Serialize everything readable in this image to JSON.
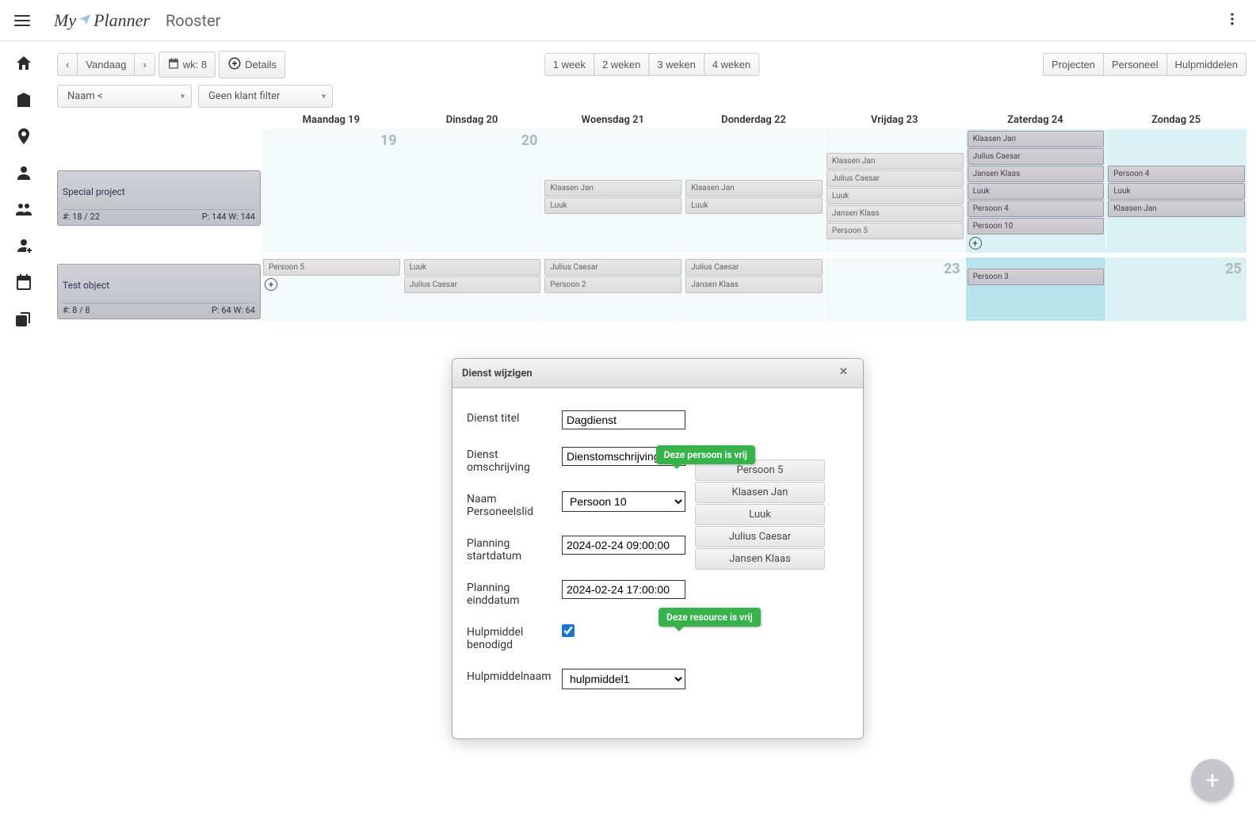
{
  "app": {
    "logo_left": "My",
    "logo_right": "Planner",
    "page_title": "Rooster"
  },
  "toolbar": {
    "prev": "‹",
    "today": "Vandaag",
    "next": "›",
    "week_label": "wk: 8",
    "details": "Details",
    "ranges": [
      "1 week",
      "2 weken",
      "3 weken",
      "4 weken"
    ],
    "right_tabs": [
      "Projecten",
      "Personeel",
      "Hulpmiddelen"
    ]
  },
  "filters": {
    "sort": "Naam <",
    "client": "Geen klant filter"
  },
  "days": [
    "Maandag 19",
    "Dinsdag 20",
    "Woensdag 21",
    "Donderdag 22",
    "Vrijdag 23",
    "Zaterdag 24",
    "Zondag 25"
  ],
  "daynums": {
    "mon": "19",
    "tue": "20",
    "fri": "23",
    "sun": "25"
  },
  "projects": [
    {
      "name": "Special project",
      "count": "#: 18 / 22",
      "pw": "P: 144 W: 144",
      "cells": {
        "wed": [
          "Klaasen Jan",
          "Luuk"
        ],
        "thu": [
          "Klaasen Jan",
          "Luuk"
        ],
        "fri": [
          "Klaasen Jan",
          "Julius Caesar",
          "Luuk",
          "Jansen Klaas",
          "Persoon 5"
        ],
        "sat": [
          "Klaasen Jan",
          "Julius Caesar",
          "Jansen Klaas",
          "Luuk",
          "Persoon 4",
          "Persoon 10"
        ],
        "sun": [
          "Persoon 4",
          "Luuk",
          "Klaasen Jan"
        ]
      }
    },
    {
      "name": "Test object",
      "count": "#: 8 / 8",
      "pw": "P: 64 W: 64",
      "cells": {
        "mon": [
          "Persoon 5"
        ],
        "tue": [
          "Luuk",
          "Julius Caesar"
        ],
        "wed": [
          "Julius Caesar",
          "Persoon 2"
        ],
        "thu": [
          "Julius Caesar",
          "Jansen Klaas"
        ],
        "sat": [
          "Persoon 3"
        ]
      }
    }
  ],
  "dialog": {
    "title": "Dienst wijzigen",
    "fields": {
      "title_label": "Dienst titel",
      "title_value": "Dagdienst",
      "desc_label": "Dienst omschrijving",
      "desc_value": "Dienstomschrijving",
      "person_label": "Naam Personeelslid",
      "person_value": "Persoon 10",
      "start_label": "Planning startdatum",
      "start_value": "2024-02-24 09:00:00",
      "end_label": "Planning einddatum",
      "end_value": "2024-02-24 17:00:00",
      "resource_needed_label": "Hulpmiddel benodigd",
      "resource_name_label": "Hulpmiddelnaam",
      "resource_name_value": "hulpmiddel1"
    },
    "suggestions": [
      "Persoon 5",
      "Klaasen Jan",
      "Luuk",
      "Julius Caesar",
      "Jansen Klaas"
    ],
    "tooltip_person": "Deze persoon is vrij",
    "tooltip_resource": "Deze resource is vrij"
  }
}
